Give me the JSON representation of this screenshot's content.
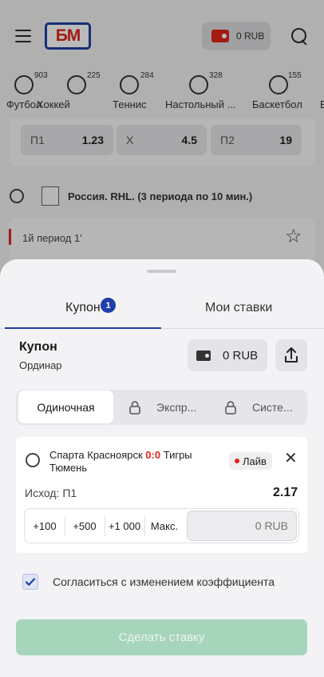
{
  "header": {
    "logo_text": "БМ",
    "balance": "0 RUB"
  },
  "sports": [
    {
      "name": "Футбол",
      "count": "903",
      "icon": "soccer-ball-icon"
    },
    {
      "name": "Хоккей",
      "count": "225",
      "icon": "hockey-puck-icon"
    },
    {
      "name": "Теннис",
      "count": "284",
      "icon": "tennis-ball-icon"
    },
    {
      "name": "Настольный ...",
      "count": "328",
      "icon": "table-tennis-icon"
    },
    {
      "name": "Баскетбол",
      "count": "155",
      "icon": "basketball-icon"
    },
    {
      "name": "В",
      "count": "",
      "icon": ""
    }
  ],
  "odds_row": [
    {
      "label": "П1",
      "value": "1.23"
    },
    {
      "label": "Х",
      "value": "4.5"
    },
    {
      "label": "П2",
      "value": "19"
    }
  ],
  "league": {
    "title": "Россия. RHL. (3 периода по 10 мин.)"
  },
  "match": {
    "period": "1й период 1'"
  },
  "sheet": {
    "tabs": [
      {
        "label": "Купон",
        "badge": "1",
        "active": true
      },
      {
        "label": "Мои ставки",
        "active": false
      }
    ],
    "coupon": {
      "title": "Купон",
      "type": "Ординар",
      "balance": "0 RUB"
    },
    "bet_types": [
      {
        "label": "Одиночная",
        "active": true,
        "locked": false
      },
      {
        "label": "Экспр...",
        "active": false,
        "locked": true
      },
      {
        "label": "Систе...",
        "active": false,
        "locked": true
      }
    ],
    "bet": {
      "team1": "Спарта Красноярск",
      "score": "0:0",
      "team2": "Тигры Тюмень",
      "live_label": "Лайв",
      "outcome_label": "Исход: П1",
      "odds": "2.17",
      "quick_stakes": [
        "+100",
        "+500",
        "+1 000",
        "Макс."
      ],
      "stake_placeholder": "0 RUB"
    },
    "agree_label": "Согласиться с изменением коэффициента",
    "agree_checked": true,
    "place_bet_label": "Сделать ставку"
  },
  "colors": {
    "brand_blue": "#1e3ea8",
    "brand_red": "#e0241b",
    "place_bet_disabled": "#a7d5bb"
  }
}
